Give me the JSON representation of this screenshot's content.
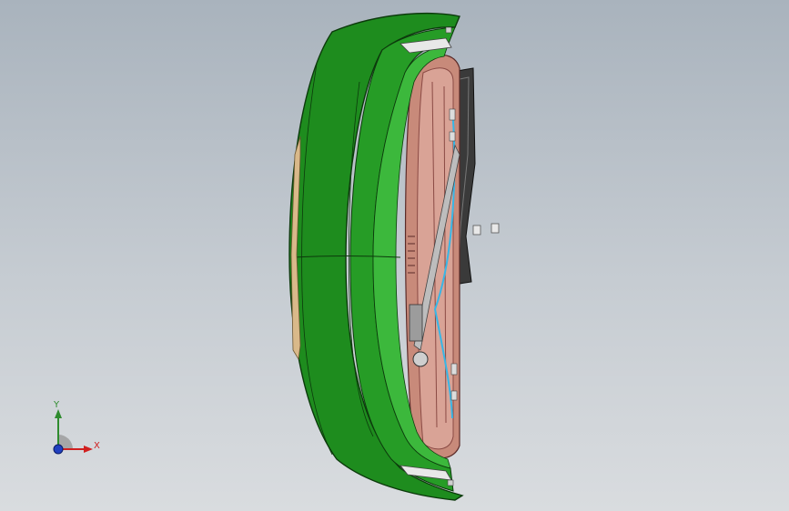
{
  "viewport": {
    "background_top": "#a9b3bd",
    "background_bottom": "#d9dcdf"
  },
  "model": {
    "part_colors": {
      "bumper_shell": "#1e8c1e",
      "bumper_highlight": "#3cb83c",
      "inner_frame": "#c88a7a",
      "inner_frame_dark": "#8a4a44",
      "grille_bracket": "#3a3a3a",
      "edge_trim": "#d9b98a",
      "accent_cyan": "#38b6e6"
    }
  },
  "triad": {
    "y_label": "Y",
    "x_label": "X",
    "y_color": "#2e8b2e",
    "x_color": "#d02020",
    "z_color": "#2040c0"
  }
}
